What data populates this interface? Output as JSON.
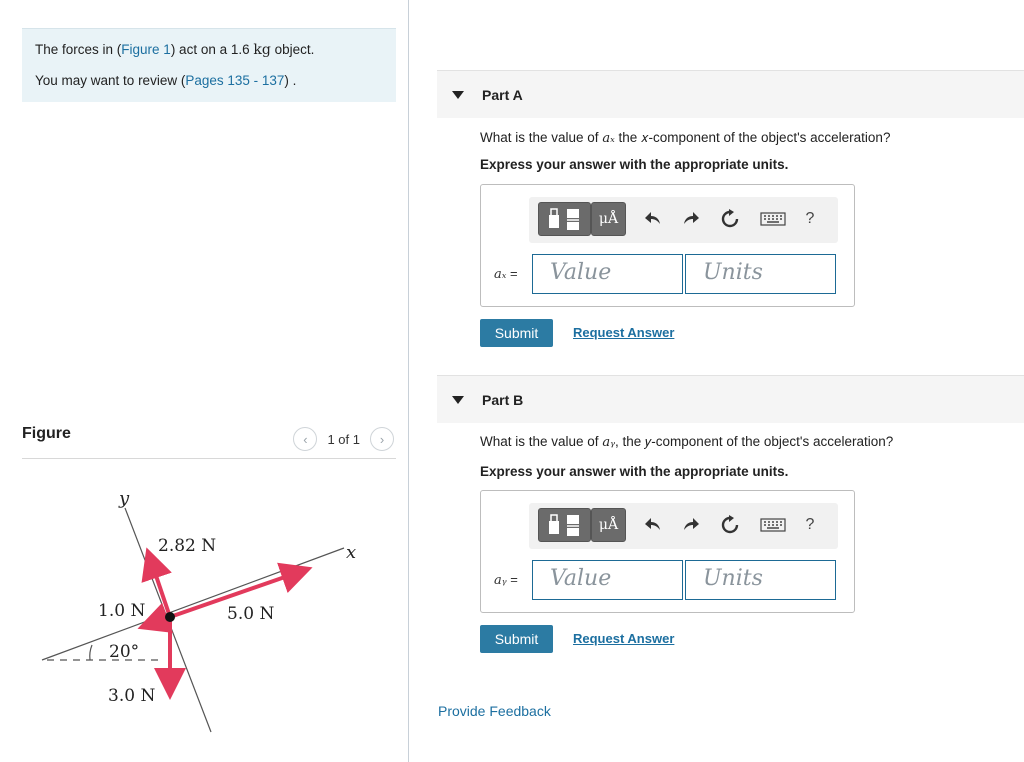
{
  "intro": {
    "line1_prefix": "The forces in (",
    "figure_link": "Figure 1",
    "line1_mid": ") act on a 1.6 ",
    "unit": "kg",
    "line1_suffix": " object.",
    "line2_prefix": "You may want to review (",
    "pages_link": "Pages 135 - 137",
    "line2_suffix": ") ."
  },
  "figure": {
    "title": "Figure",
    "pager_label": "1 of 1",
    "prev_icon": "‹",
    "next_icon": "›",
    "axis_x": "x",
    "axis_y": "y",
    "force_2_82": "2.82 N",
    "force_5_0": "5.0 N",
    "force_1_0": "1.0 N",
    "force_3_0": "3.0 N",
    "angle": "20°",
    "colors": {
      "arrow": "#e23a5c",
      "axis": "#555555"
    }
  },
  "partA": {
    "title": "Part A",
    "question_prefix": "What is the value of ",
    "question_var": "aₓ",
    "question_suffix": " the 𝑥-component of the object's acceleration?",
    "instruction": "Express your answer with the appropriate units.",
    "var_label": "aₓ",
    "equals": " =",
    "value_placeholder": "Value",
    "units_placeholder": "Units",
    "submit": "Submit",
    "request_answer": "Request Answer"
  },
  "partB": {
    "title": "Part B",
    "question_prefix": "What is the value of ",
    "question_var": "aᵧ",
    "question_suffix": ", the 𝑦-component of the object's acceleration?",
    "instruction": "Express your answer with the appropriate units.",
    "var_label": "aᵧ",
    "equals": " =",
    "value_placeholder": "Value",
    "units_placeholder": "Units",
    "submit": "Submit",
    "request_answer": "Request Answer"
  },
  "toolbar": {
    "units_label": "μÅ",
    "help_label": "?"
  },
  "feedback": "Provide Feedback"
}
